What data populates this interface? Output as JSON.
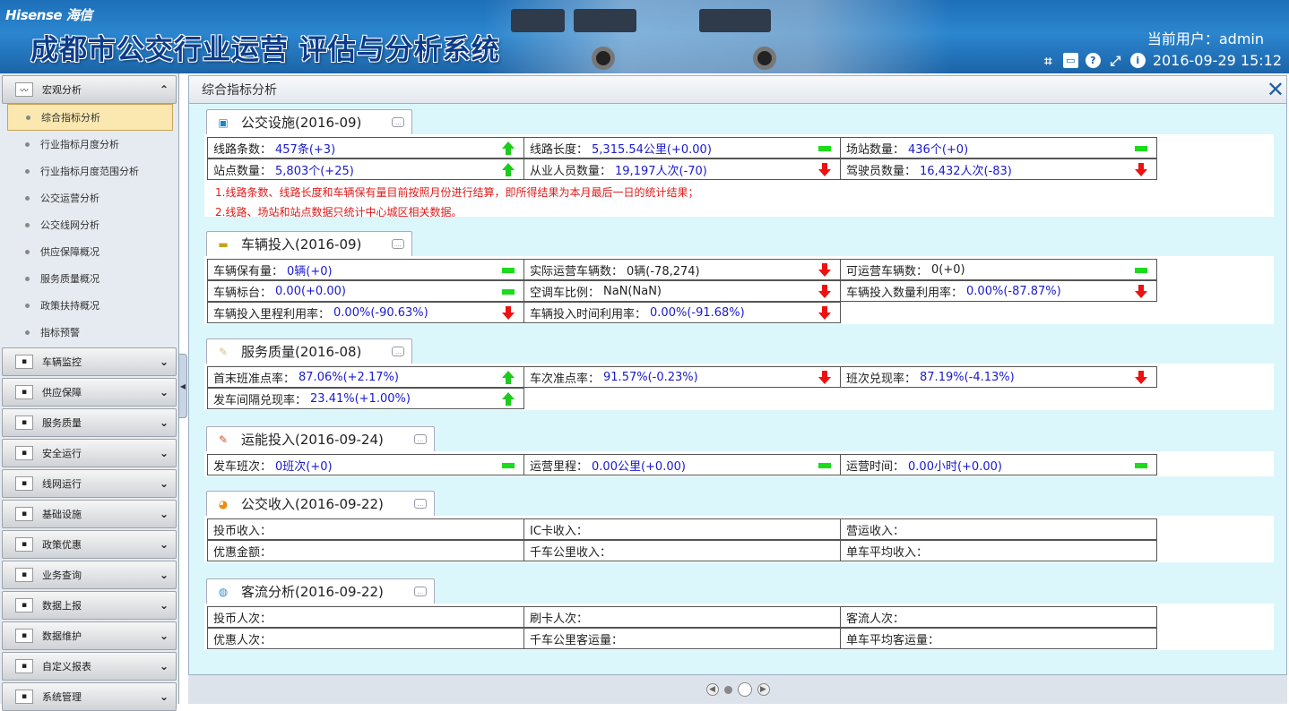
{
  "header": {
    "logo": "Hisense 海信",
    "system_title": "成都市公交行业运营 评估与分析系统",
    "user_label": "当前用户：admin",
    "datetime": "2016-09-29 15:12"
  },
  "sidebar": {
    "macro": {
      "label": "宏观分析",
      "items": [
        "综合指标分析",
        "行业指标月度分析",
        "行业指标月度范围分析",
        "公交运营分析",
        "公交线网分析",
        "供应保障概况",
        "服务质量概况",
        "政策扶持概况",
        "指标预警"
      ]
    },
    "groups": [
      "车辆监控",
      "供应保障",
      "服务质量",
      "安全运行",
      "线网运行",
      "基础设施",
      "政策优惠",
      "业务查询",
      "数据上报",
      "数据维护",
      "自定义报表",
      "系统管理"
    ]
  },
  "main": {
    "title": "综合指标分析"
  },
  "sections": [
    {
      "title": "公交设施(2016-09)",
      "rows": [
        [
          {
            "label": "线路条数：",
            "value": "457条(+3)",
            "trend": "up"
          },
          {
            "label": "线路长度：",
            "value": "5,315.54公里(+0.00)",
            "trend": "flat"
          },
          {
            "label": "场站数量：",
            "value": "436个(+0)",
            "trend": "flat"
          }
        ],
        [
          {
            "label": "站点数量：",
            "value": "5,803个(+25)",
            "trend": "up"
          },
          {
            "label": "从业人员数量：",
            "value": "19,197人次(-70)",
            "trend": "down"
          },
          {
            "label": "驾驶员数量：",
            "value": "16,432人次(-83)",
            "trend": "down"
          }
        ]
      ],
      "notes": [
        "1.线路条数、线路长度和车辆保有量目前按照月份进行结算，即所得结果为本月最后一日的统计结果；",
        "2.线路、场站和站点数据只统计中心城区相关数据。"
      ]
    },
    {
      "title": "车辆投入(2016-09)",
      "rows": [
        [
          {
            "label": "车辆保有量：",
            "value": "0辆(+0)",
            "trend": "flat"
          },
          {
            "label": "实际运营车辆数：",
            "value": "0辆(-78,274)",
            "trend": "down",
            "black": true
          },
          {
            "label": "可运营车辆数：",
            "value": "0(+0)",
            "trend": "flat",
            "black": true
          }
        ],
        [
          {
            "label": "车辆标台：",
            "value": "0.00(+0.00)",
            "trend": "flat"
          },
          {
            "label": "空调车比例：",
            "value": "NaN(NaN)",
            "trend": "down",
            "black": true
          },
          {
            "label": "车辆投入数量利用率：",
            "value": "0.00%(-87.87%)",
            "trend": "down"
          }
        ],
        [
          {
            "label": "车辆投入里程利用率：",
            "value": "0.00%(-90.63%)",
            "trend": "down"
          },
          {
            "label": "车辆投入时间利用率：",
            "value": "0.00%(-91.68%)",
            "trend": "down"
          }
        ]
      ]
    },
    {
      "title": "服务质量(2016-08)",
      "rows": [
        [
          {
            "label": "首末班准点率：",
            "value": "87.06%(+2.17%)",
            "trend": "up"
          },
          {
            "label": "车次准点率：",
            "value": "91.57%(-0.23%)",
            "trend": "down"
          },
          {
            "label": "班次兑现率：",
            "value": "87.19%(-4.13%)",
            "trend": "down"
          }
        ],
        [
          {
            "label": "发车间隔兑现率：",
            "value": "23.41%(+1.00%)",
            "trend": "up"
          }
        ]
      ]
    },
    {
      "title": "运能投入(2016-09-24)",
      "rows": [
        [
          {
            "label": "发车班次：",
            "value": "0班次(+0)",
            "trend": "flat"
          },
          {
            "label": "运营里程：",
            "value": "0.00公里(+0.00)",
            "trend": "flat"
          },
          {
            "label": "运营时间：",
            "value": "0.00小时(+0.00)",
            "trend": "flat"
          }
        ]
      ]
    },
    {
      "title": "公交收入(2016-09-22)",
      "rows": [
        [
          {
            "label": "投币收入：",
            "value": ""
          },
          {
            "label": "IC卡收入：",
            "value": ""
          },
          {
            "label": "营运收入：",
            "value": ""
          }
        ],
        [
          {
            "label": "优惠金额：",
            "value": ""
          },
          {
            "label": "千车公里收入：",
            "value": ""
          },
          {
            "label": "单车平均收入：",
            "value": ""
          }
        ]
      ]
    },
    {
      "title": "客流分析(2016-09-22)",
      "rows": [
        [
          {
            "label": "投币人次：",
            "value": ""
          },
          {
            "label": "刷卡人次：",
            "value": ""
          },
          {
            "label": "客流人次：",
            "value": ""
          }
        ],
        [
          {
            "label": "优惠人次：",
            "value": ""
          },
          {
            "label": "千车公里客运量：",
            "value": ""
          },
          {
            "label": "单车平均客运量：",
            "value": ""
          }
        ]
      ]
    }
  ]
}
